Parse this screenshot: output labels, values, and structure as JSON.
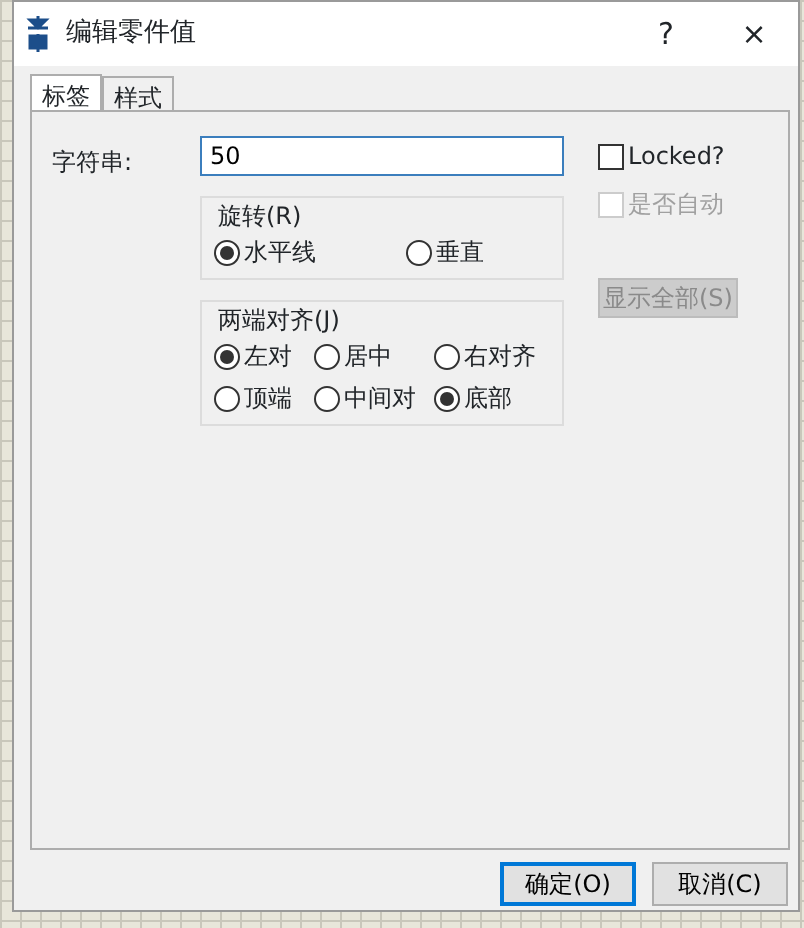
{
  "window": {
    "title": "编辑零件值",
    "help": "?",
    "close": "×"
  },
  "tabs": [
    {
      "label": "标签",
      "selected": true
    },
    {
      "label": "样式",
      "selected": false
    }
  ],
  "string_field": {
    "label": "字符串:",
    "value": "50"
  },
  "checkboxes": [
    {
      "label": "Locked?",
      "checked": false,
      "disabled": false
    },
    {
      "label": "是否自动",
      "checked": false,
      "disabled": true
    }
  ],
  "rotation": {
    "title": "旋转(R)",
    "options": [
      {
        "label": "水平线",
        "selected": true
      },
      {
        "label": "垂直",
        "selected": false
      }
    ]
  },
  "justify": {
    "title": "两端对齐(J)",
    "options": [
      {
        "label": "左对",
        "selected": true
      },
      {
        "label": "居中",
        "selected": false
      },
      {
        "label": "右对齐",
        "selected": false
      },
      {
        "label": "顶端",
        "selected": false
      },
      {
        "label": "中间对",
        "selected": false
      },
      {
        "label": "底部",
        "selected": true
      }
    ]
  },
  "show_all_button": {
    "label": "显示全部(S)",
    "disabled": true
  },
  "buttons": [
    {
      "label": "确定(O)",
      "default": true
    },
    {
      "label": "取消(C)",
      "default": false
    }
  ]
}
